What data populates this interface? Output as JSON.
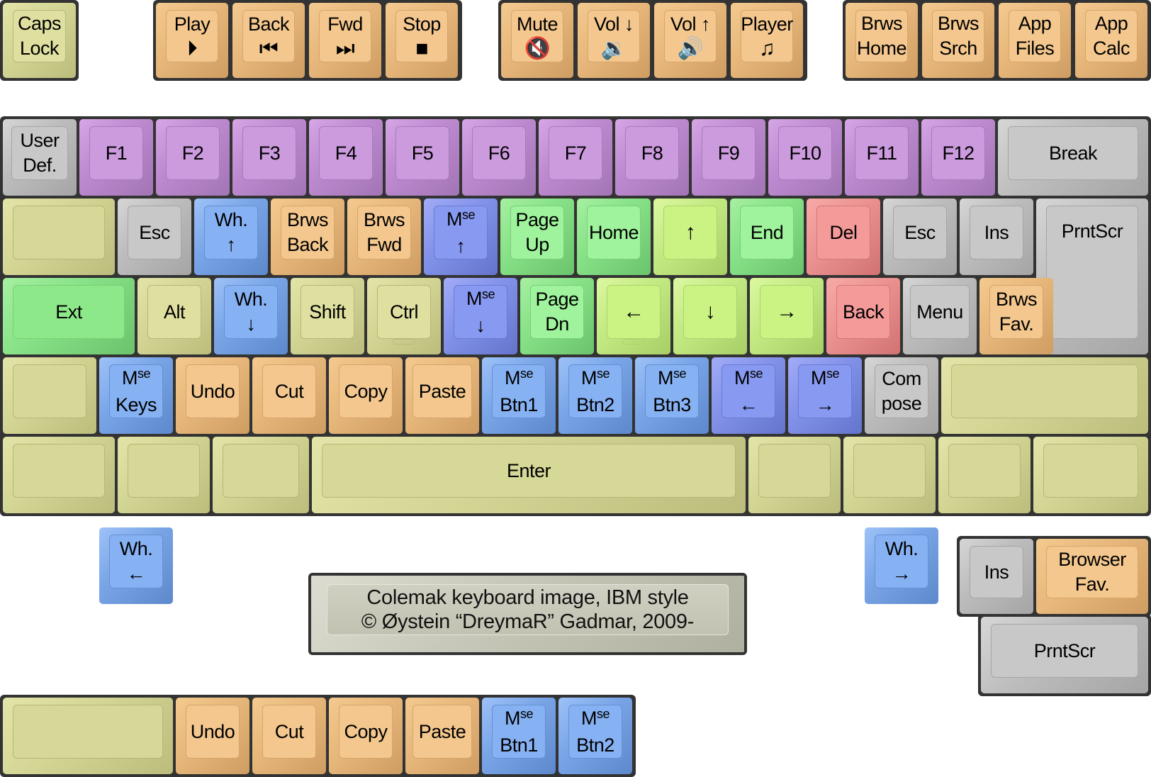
{
  "title": "Colemak keyboard image, IBM style",
  "credit": "© Øystein “DreymaR” Gadmar, 2009-",
  "colors": {
    "plate": "#333333",
    "olive": "#d6d897",
    "orange": "#f3c78e",
    "purple": "#cb9bde",
    "gray": "#c8c8c8",
    "blue": "#86b1f2",
    "indigo": "#8899f1",
    "green": "#9ff39c",
    "lime": "#cbf383",
    "red": "#f49b9a"
  },
  "keys": {
    "caps_lock": [
      "Caps",
      "Lock"
    ],
    "media": [
      {
        "label": "Play",
        "icon": "play-pause-icon",
        "glyph": "⏵"
      },
      {
        "label": "Back",
        "icon": "skip-back-icon",
        "glyph": "⏮"
      },
      {
        "label": "Fwd",
        "icon": "skip-forward-icon",
        "glyph": "⏭"
      },
      {
        "label": "Stop",
        "icon": "stop-icon",
        "glyph": "■"
      }
    ],
    "volume": [
      {
        "label": "Mute",
        "icon": "mute-icon",
        "glyph": "🔇"
      },
      {
        "label": "Vol ↓",
        "icon": "volume-down-icon",
        "glyph": "🔉"
      },
      {
        "label": "Vol ↑",
        "icon": "volume-up-icon",
        "glyph": "🔊"
      },
      {
        "label": "Player",
        "icon": "music-note-icon",
        "glyph": "♫"
      }
    ],
    "apps": [
      [
        "Brws",
        "Home"
      ],
      [
        "Brws",
        "Srch"
      ],
      [
        "App",
        "Files"
      ],
      [
        "App",
        "Calc"
      ]
    ],
    "row_f": {
      "user_def": [
        "User",
        "Def."
      ],
      "fkeys": [
        "F1",
        "F2",
        "F3",
        "F4",
        "F5",
        "F6",
        "F7",
        "F8",
        "F9",
        "F10",
        "F11",
        "F12"
      ],
      "break": "Break"
    },
    "row_1": {
      "esc": "Esc",
      "wheel_up": [
        "Wh.",
        "↑"
      ],
      "brws_back": [
        "Brws",
        "Back"
      ],
      "brws_fwd": [
        "Brws",
        "Fwd"
      ],
      "mouse_up": [
        "M",
        "se",
        "↑"
      ],
      "page_up": [
        "Page",
        "Up"
      ],
      "home": "Home",
      "up": "↑",
      "end": "End",
      "del": "Del",
      "esc2": "Esc",
      "ins": "Ins",
      "prntscr": "PrntScr"
    },
    "row_2": {
      "ext": "Ext",
      "alt": "Alt",
      "wheel_down": [
        "Wh.",
        "↓"
      ],
      "shift": "Shift",
      "ctrl": "Ctrl",
      "mouse_down": [
        "M",
        "se",
        "↓"
      ],
      "page_dn": [
        "Page",
        "Dn"
      ],
      "left": "←",
      "down": "↓",
      "right": "→",
      "back": "Back",
      "menu": "Menu",
      "brws_fav": [
        "Brws",
        "Fav."
      ]
    },
    "row_3": {
      "mouse_keys": [
        "M",
        "se",
        "Keys"
      ],
      "undo": "Undo",
      "cut": "Cut",
      "copy": "Copy",
      "paste": "Paste",
      "btn1": [
        "M",
        "se",
        "Btn1"
      ],
      "btn2": [
        "M",
        "se",
        "Btn2"
      ],
      "btn3": [
        "M",
        "se",
        "Btn3"
      ],
      "mouse_left": [
        "M",
        "se",
        "←"
      ],
      "mouse_right": [
        "M",
        "se",
        "→"
      ],
      "compose": [
        "Com",
        "pose"
      ]
    },
    "row_4": {
      "enter": "Enter"
    },
    "wheel_left": [
      "Wh.",
      "←"
    ],
    "wheel_right": [
      "Wh.",
      "→"
    ],
    "iso_cluster": {
      "ins": "Ins",
      "browser_fav": [
        "Browser",
        "Fav."
      ],
      "prntscr": "PrntScr"
    },
    "thumb_row": {
      "undo": "Undo",
      "cut": "Cut",
      "copy": "Copy",
      "paste": "Paste",
      "btn1": [
        "M",
        "se",
        "Btn1"
      ],
      "btn2": [
        "M",
        "se",
        "Btn2"
      ]
    }
  }
}
